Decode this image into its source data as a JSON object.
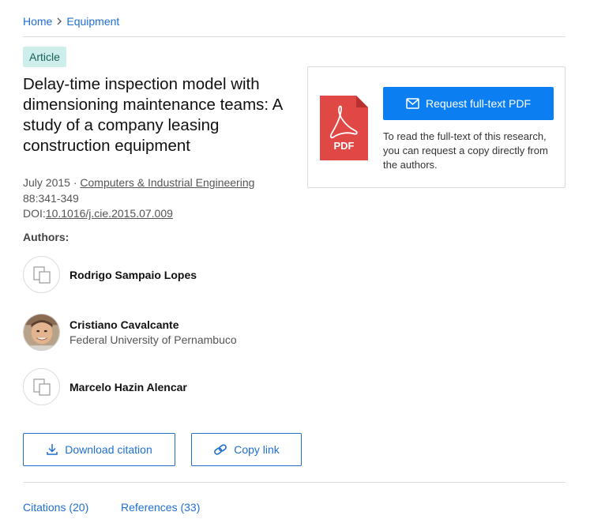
{
  "breadcrumb": {
    "home": "Home",
    "current": "Equipment"
  },
  "badge": "Article",
  "title": "Delay-time inspection model with dimensioning maintenance teams: A study of a company leasing construction equipment",
  "meta": {
    "date": "July 2015",
    "separator": " · ",
    "journal": "Computers & Industrial Engineering",
    "pages": "88:341-349",
    "doi_prefix": "DOI:",
    "doi": "10.1016/j.cie.2015.07.009"
  },
  "authors_label": "Authors:",
  "authors": [
    {
      "name": "Rodrigo Sampaio Lopes",
      "affiliation": "",
      "avatar": "placeholder-avatar-icon"
    },
    {
      "name": "Cristiano Cavalcante",
      "affiliation": "Federal University of Pernambuco",
      "avatar": "photo"
    },
    {
      "name": "Marcelo Hazin Alencar",
      "affiliation": "",
      "avatar": "placeholder-avatar-icon"
    }
  ],
  "actions": {
    "download_citation": "Download citation",
    "copy_link": "Copy link"
  },
  "tabs": {
    "citations": "Citations (20)",
    "references": "References (33)"
  },
  "pdf_card": {
    "icon_label": "PDF",
    "request_button": "Request full-text PDF",
    "description": "To read the full-text of this research, you can request a copy directly from the authors."
  },
  "colors": {
    "link": "#1f6fd1",
    "primary_button": "#0b7ff2",
    "badge_bg": "#cdeeea",
    "pdf_red": "#e04846"
  }
}
